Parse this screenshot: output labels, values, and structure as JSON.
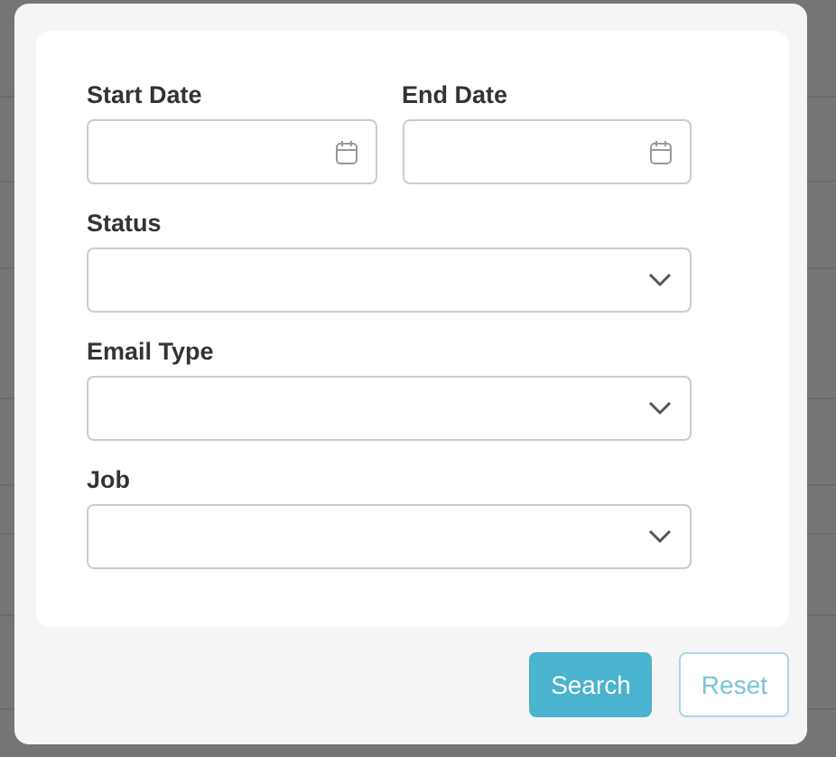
{
  "filter_dialog": {
    "date_fields": [
      {
        "label": "Start Date"
      },
      {
        "label": "End Date"
      }
    ],
    "selects": [
      {
        "label": "Status"
      },
      {
        "label": "Email Type"
      },
      {
        "label": "Job"
      }
    ],
    "buttons": [
      {
        "label": "Search",
        "kind": "primary"
      },
      {
        "label": "Reset",
        "kind": "outline"
      }
    ]
  }
}
